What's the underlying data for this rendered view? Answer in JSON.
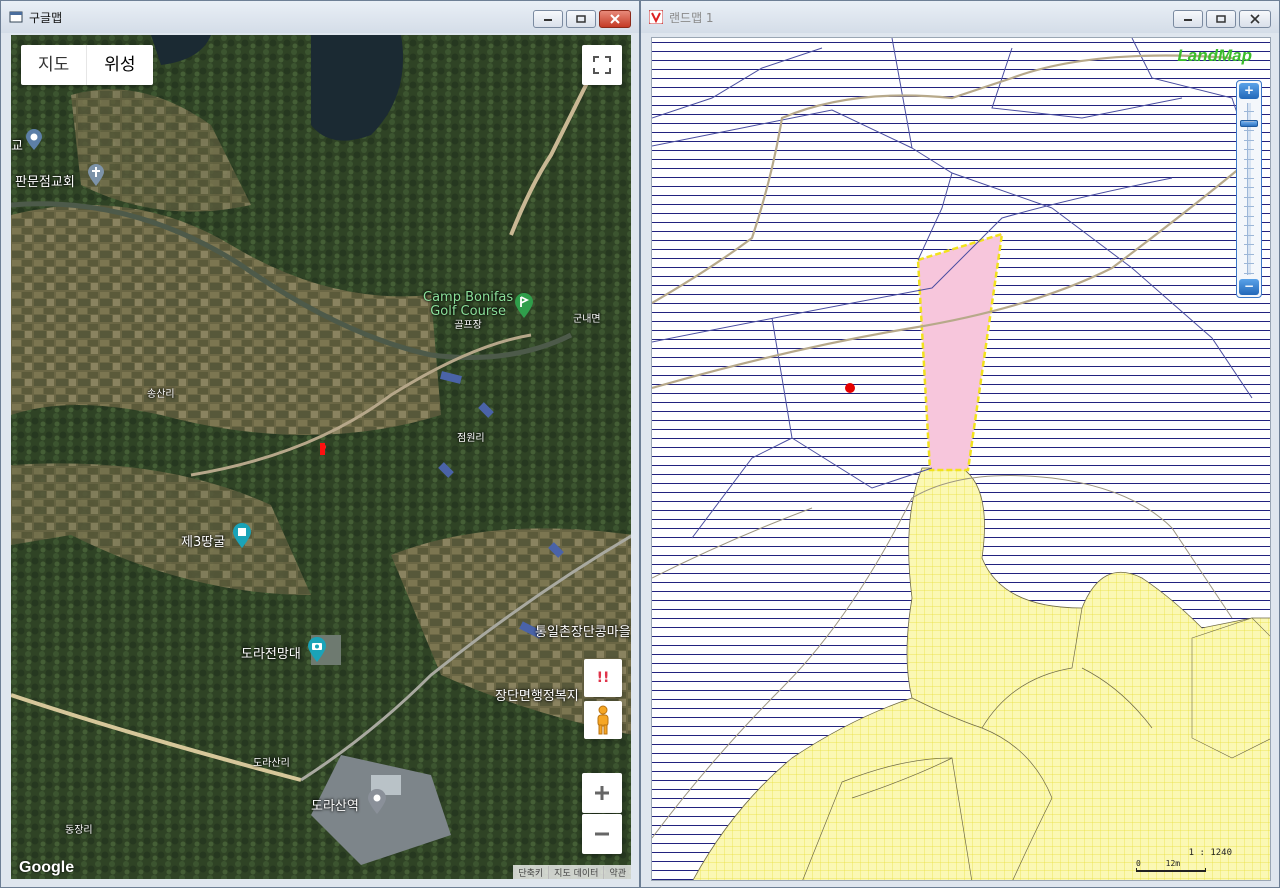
{
  "left_window": {
    "title": "구글맵",
    "map_type": {
      "map": "지도",
      "satellite": "위성",
      "selected": "위성"
    },
    "places": {
      "church": "판문점교회",
      "church_partial": "교",
      "golf_line1": "Camp Bonifas",
      "golf_line2": "Golf Course",
      "golf_sub": "골프장",
      "gunnae": "군내면",
      "songsan": "송산리",
      "jeomwon": "점원리",
      "tunnel": "제3땅굴",
      "observatory": "도라전망대",
      "tongil": "통일촌장단콩마을",
      "jangdan": "장단면행정복지",
      "dorasan_ri": "도라산리",
      "dorasan_station": "도라산역",
      "dongjang": "동장리"
    },
    "google_logo": "Google",
    "footer": {
      "shortcuts": "단축키",
      "map_data": "지도 데이터",
      "terms": "약관"
    },
    "alert_glyph": "!!"
  },
  "right_window": {
    "title": "랜드맵 1",
    "logo": "LandMap",
    "scale_ratio": "1 : 1240",
    "scale_zero": "0",
    "scale_len": "12m",
    "zoom_level": 0.1
  },
  "colors": {
    "parcel_highlight": "#f7c6dc",
    "parcel_outline": "#f2e21c",
    "hatch_line": "#22227f",
    "yellow_zone": "#fbf8b4",
    "road": "#b7a98a",
    "marker": "#e60000"
  },
  "icons": [
    "window-icon",
    "minimize-icon",
    "maximize-icon",
    "close-icon",
    "fullscreen-icon",
    "pegman-icon",
    "zoom-in-icon",
    "zoom-out-icon",
    "landmap-logo-icon"
  ]
}
